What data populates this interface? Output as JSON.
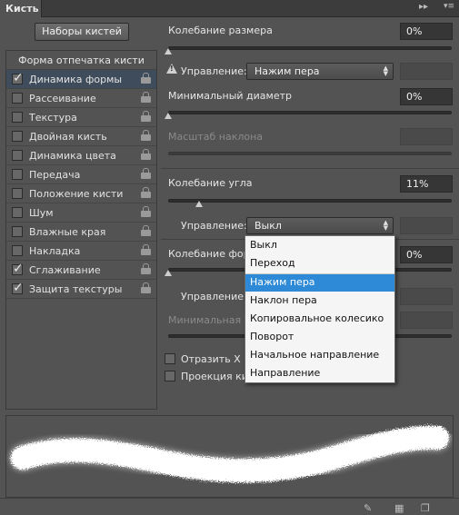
{
  "window": {
    "tab_title": "Кисть"
  },
  "left": {
    "presets_button": "Наборы кистей",
    "header": "Форма отпечатка кисти",
    "items": [
      {
        "label": "Динамика формы",
        "checked": true,
        "selected": true
      },
      {
        "label": "Рассеивание",
        "checked": false
      },
      {
        "label": "Текстура",
        "checked": false
      },
      {
        "label": "Двойная кисть",
        "checked": false
      },
      {
        "label": "Динамика цвета",
        "checked": false
      },
      {
        "label": "Передача",
        "checked": false
      },
      {
        "label": "Положение кисти",
        "checked": false
      },
      {
        "label": "Шум",
        "checked": false
      },
      {
        "label": "Влажные края",
        "checked": false
      },
      {
        "label": "Накладка",
        "checked": false
      },
      {
        "label": "Сглаживание",
        "checked": true
      },
      {
        "label": "Защита текстуры",
        "checked": true
      }
    ]
  },
  "right": {
    "size_jitter": {
      "label": "Колебание размера",
      "value": "0%"
    },
    "control1": {
      "label": "Управление:",
      "value": "Нажим пера"
    },
    "min_diameter": {
      "label": "Минимальный диаметр",
      "value": "0%"
    },
    "tilt_scale": {
      "label": "Масштаб наклона"
    },
    "angle_jitter": {
      "label": "Колебание угла",
      "value": "11%"
    },
    "control2": {
      "label": "Управление:",
      "value": "Выкл"
    },
    "roundness_jitter": {
      "label": "Колебание формы",
      "value": "0%"
    },
    "control3": {
      "label": "Управление:"
    },
    "min_roundness": {
      "label": "Минимальная форма"
    },
    "flip_x": {
      "label": "Отразить X колебания"
    },
    "brush_projection": {
      "label": "Проекция кисти"
    }
  },
  "dropdown": {
    "items": [
      "Выкл",
      "Переход",
      "Нажим пера",
      "Наклон пера",
      "Копировальное колесико",
      "Поворот",
      "Начальное направление",
      "Направление"
    ],
    "highlighted": "Нажим пера"
  },
  "icons": {
    "collapse": "double-chevron-right-icon",
    "close": "close-icon",
    "menu": "panel-menu-icon",
    "lock": "lock-icon",
    "warning": "warning-icon",
    "bottom": [
      "brush-tool-icon",
      "grid-icon",
      "new-preset-icon"
    ]
  },
  "colors": {
    "highlight": "#2e8ad6",
    "panel": "#535353",
    "selected_row": "#3f4c5b"
  }
}
